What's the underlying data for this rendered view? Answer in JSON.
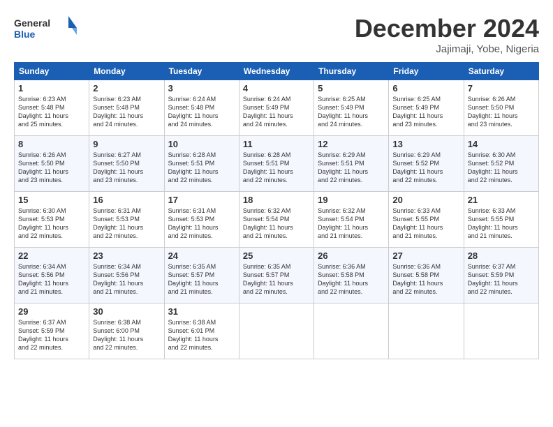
{
  "header": {
    "logo_line1": "General",
    "logo_line2": "Blue",
    "month": "December 2024",
    "location": "Jajimaji, Yobe, Nigeria"
  },
  "days_of_week": [
    "Sunday",
    "Monday",
    "Tuesday",
    "Wednesday",
    "Thursday",
    "Friday",
    "Saturday"
  ],
  "weeks": [
    [
      {
        "day": "1",
        "info": "Sunrise: 6:23 AM\nSunset: 5:48 PM\nDaylight: 11 hours\nand 25 minutes."
      },
      {
        "day": "2",
        "info": "Sunrise: 6:23 AM\nSunset: 5:48 PM\nDaylight: 11 hours\nand 24 minutes."
      },
      {
        "day": "3",
        "info": "Sunrise: 6:24 AM\nSunset: 5:48 PM\nDaylight: 11 hours\nand 24 minutes."
      },
      {
        "day": "4",
        "info": "Sunrise: 6:24 AM\nSunset: 5:49 PM\nDaylight: 11 hours\nand 24 minutes."
      },
      {
        "day": "5",
        "info": "Sunrise: 6:25 AM\nSunset: 5:49 PM\nDaylight: 11 hours\nand 24 minutes."
      },
      {
        "day": "6",
        "info": "Sunrise: 6:25 AM\nSunset: 5:49 PM\nDaylight: 11 hours\nand 23 minutes."
      },
      {
        "day": "7",
        "info": "Sunrise: 6:26 AM\nSunset: 5:50 PM\nDaylight: 11 hours\nand 23 minutes."
      }
    ],
    [
      {
        "day": "8",
        "info": "Sunrise: 6:26 AM\nSunset: 5:50 PM\nDaylight: 11 hours\nand 23 minutes."
      },
      {
        "day": "9",
        "info": "Sunrise: 6:27 AM\nSunset: 5:50 PM\nDaylight: 11 hours\nand 23 minutes."
      },
      {
        "day": "10",
        "info": "Sunrise: 6:28 AM\nSunset: 5:51 PM\nDaylight: 11 hours\nand 22 minutes."
      },
      {
        "day": "11",
        "info": "Sunrise: 6:28 AM\nSunset: 5:51 PM\nDaylight: 11 hours\nand 22 minutes."
      },
      {
        "day": "12",
        "info": "Sunrise: 6:29 AM\nSunset: 5:51 PM\nDaylight: 11 hours\nand 22 minutes."
      },
      {
        "day": "13",
        "info": "Sunrise: 6:29 AM\nSunset: 5:52 PM\nDaylight: 11 hours\nand 22 minutes."
      },
      {
        "day": "14",
        "info": "Sunrise: 6:30 AM\nSunset: 5:52 PM\nDaylight: 11 hours\nand 22 minutes."
      }
    ],
    [
      {
        "day": "15",
        "info": "Sunrise: 6:30 AM\nSunset: 5:53 PM\nDaylight: 11 hours\nand 22 minutes."
      },
      {
        "day": "16",
        "info": "Sunrise: 6:31 AM\nSunset: 5:53 PM\nDaylight: 11 hours\nand 22 minutes."
      },
      {
        "day": "17",
        "info": "Sunrise: 6:31 AM\nSunset: 5:53 PM\nDaylight: 11 hours\nand 22 minutes."
      },
      {
        "day": "18",
        "info": "Sunrise: 6:32 AM\nSunset: 5:54 PM\nDaylight: 11 hours\nand 21 minutes."
      },
      {
        "day": "19",
        "info": "Sunrise: 6:32 AM\nSunset: 5:54 PM\nDaylight: 11 hours\nand 21 minutes."
      },
      {
        "day": "20",
        "info": "Sunrise: 6:33 AM\nSunset: 5:55 PM\nDaylight: 11 hours\nand 21 minutes."
      },
      {
        "day": "21",
        "info": "Sunrise: 6:33 AM\nSunset: 5:55 PM\nDaylight: 11 hours\nand 21 minutes."
      }
    ],
    [
      {
        "day": "22",
        "info": "Sunrise: 6:34 AM\nSunset: 5:56 PM\nDaylight: 11 hours\nand 21 minutes."
      },
      {
        "day": "23",
        "info": "Sunrise: 6:34 AM\nSunset: 5:56 PM\nDaylight: 11 hours\nand 21 minutes."
      },
      {
        "day": "24",
        "info": "Sunrise: 6:35 AM\nSunset: 5:57 PM\nDaylight: 11 hours\nand 21 minutes."
      },
      {
        "day": "25",
        "info": "Sunrise: 6:35 AM\nSunset: 5:57 PM\nDaylight: 11 hours\nand 22 minutes."
      },
      {
        "day": "26",
        "info": "Sunrise: 6:36 AM\nSunset: 5:58 PM\nDaylight: 11 hours\nand 22 minutes."
      },
      {
        "day": "27",
        "info": "Sunrise: 6:36 AM\nSunset: 5:58 PM\nDaylight: 11 hours\nand 22 minutes."
      },
      {
        "day": "28",
        "info": "Sunrise: 6:37 AM\nSunset: 5:59 PM\nDaylight: 11 hours\nand 22 minutes."
      }
    ],
    [
      {
        "day": "29",
        "info": "Sunrise: 6:37 AM\nSunset: 5:59 PM\nDaylight: 11 hours\nand 22 minutes."
      },
      {
        "day": "30",
        "info": "Sunrise: 6:38 AM\nSunset: 6:00 PM\nDaylight: 11 hours\nand 22 minutes."
      },
      {
        "day": "31",
        "info": "Sunrise: 6:38 AM\nSunset: 6:01 PM\nDaylight: 11 hours\nand 22 minutes."
      },
      {
        "day": "",
        "info": ""
      },
      {
        "day": "",
        "info": ""
      },
      {
        "day": "",
        "info": ""
      },
      {
        "day": "",
        "info": ""
      }
    ]
  ]
}
